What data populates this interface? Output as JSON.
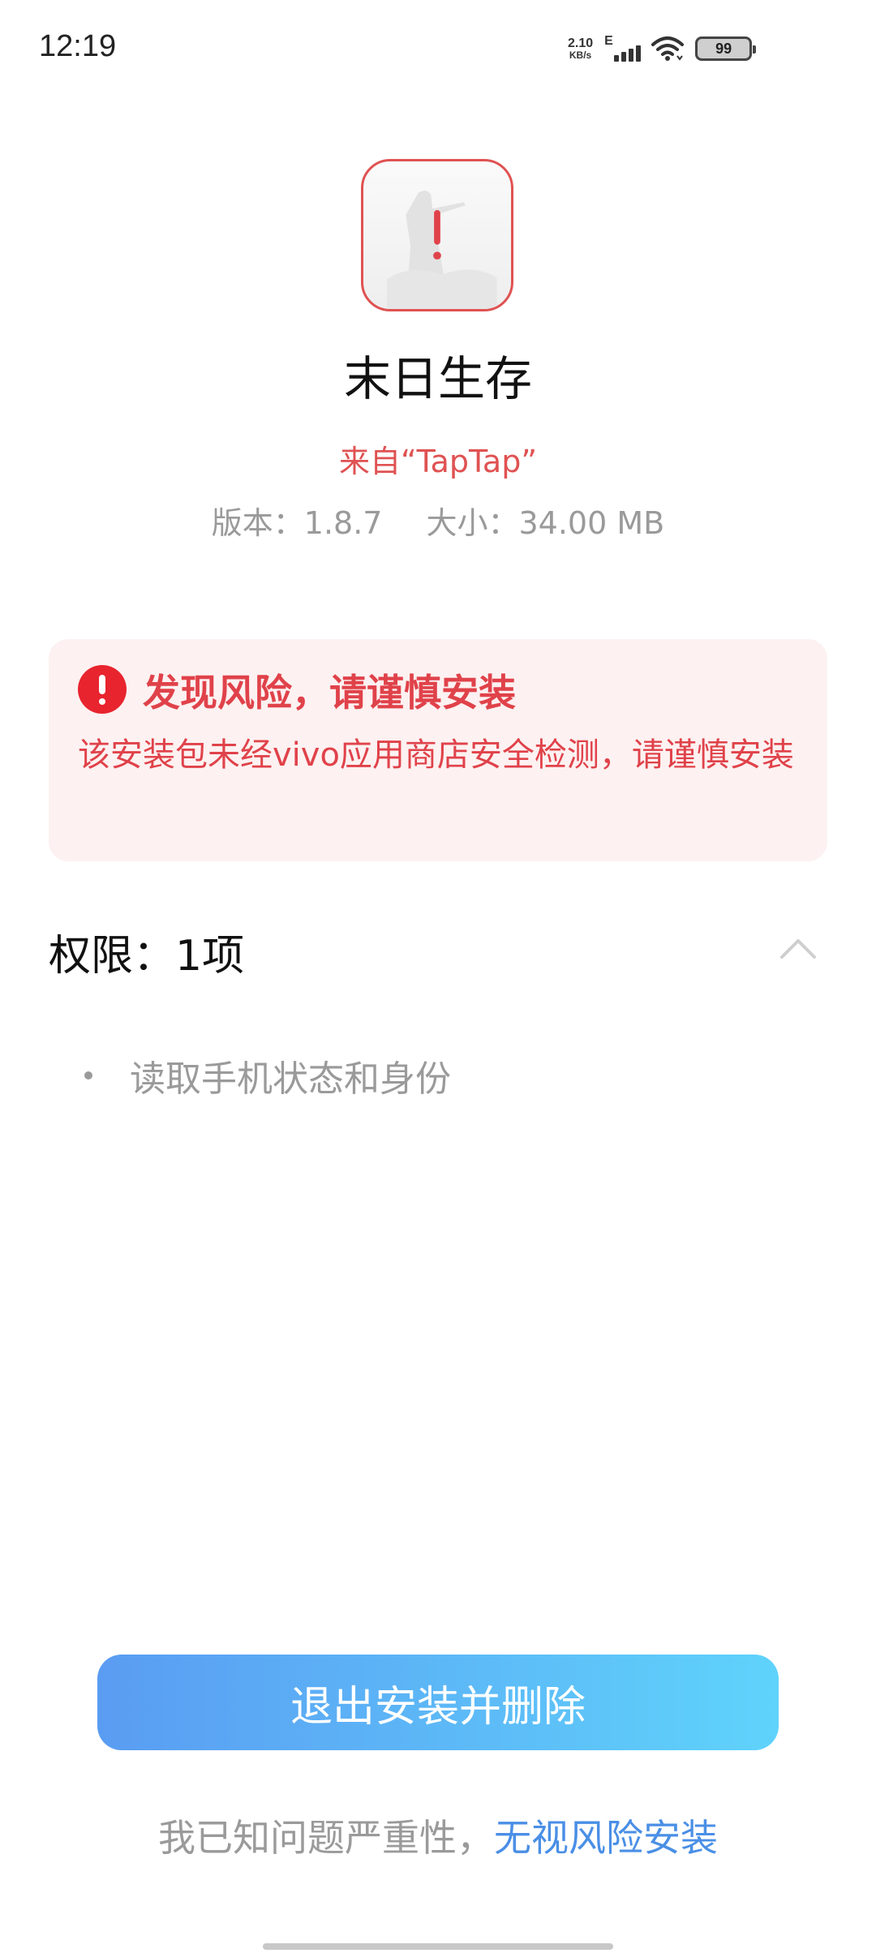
{
  "status_bar": {
    "time": "12:19",
    "net_speed_value": "2.10",
    "net_speed_unit": "KB/s",
    "network_type": "E",
    "battery": "99"
  },
  "app": {
    "icon": "warning-app-icon",
    "name": "末日生存",
    "source": "来自“TapTap”",
    "version": "版本：1.8.7",
    "size": "大小：34.00 MB"
  },
  "risk": {
    "title": "发现风险，请谨慎安装",
    "description": "该安装包未经vivo应用商店安全检测，请谨慎安装",
    "color": "#e0424a",
    "background": "#fdf1f1"
  },
  "permissions": {
    "title": "权限：1项",
    "items": [
      {
        "label": "读取手机状态和身份"
      }
    ]
  },
  "actions": {
    "exit_label": "退出安装并删除",
    "ignore_prefix": "我已知问题严重性，",
    "ignore_link": "无视风险安装",
    "accent": "#4a8fe6"
  }
}
